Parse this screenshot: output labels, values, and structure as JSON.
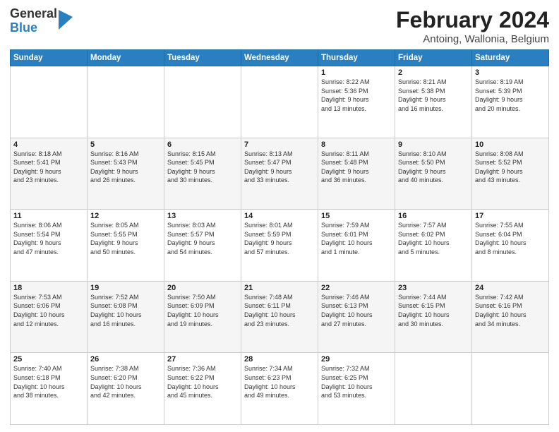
{
  "header": {
    "logo": {
      "general": "General",
      "blue": "Blue"
    },
    "title": "February 2024",
    "subtitle": "Antoing, Wallonia, Belgium"
  },
  "weekdays": [
    "Sunday",
    "Monday",
    "Tuesday",
    "Wednesday",
    "Thursday",
    "Friday",
    "Saturday"
  ],
  "weeks": [
    [
      {
        "day": "",
        "info": ""
      },
      {
        "day": "",
        "info": ""
      },
      {
        "day": "",
        "info": ""
      },
      {
        "day": "",
        "info": ""
      },
      {
        "day": "1",
        "info": "Sunrise: 8:22 AM\nSunset: 5:36 PM\nDaylight: 9 hours\nand 13 minutes."
      },
      {
        "day": "2",
        "info": "Sunrise: 8:21 AM\nSunset: 5:38 PM\nDaylight: 9 hours\nand 16 minutes."
      },
      {
        "day": "3",
        "info": "Sunrise: 8:19 AM\nSunset: 5:39 PM\nDaylight: 9 hours\nand 20 minutes."
      }
    ],
    [
      {
        "day": "4",
        "info": "Sunrise: 8:18 AM\nSunset: 5:41 PM\nDaylight: 9 hours\nand 23 minutes."
      },
      {
        "day": "5",
        "info": "Sunrise: 8:16 AM\nSunset: 5:43 PM\nDaylight: 9 hours\nand 26 minutes."
      },
      {
        "day": "6",
        "info": "Sunrise: 8:15 AM\nSunset: 5:45 PM\nDaylight: 9 hours\nand 30 minutes."
      },
      {
        "day": "7",
        "info": "Sunrise: 8:13 AM\nSunset: 5:47 PM\nDaylight: 9 hours\nand 33 minutes."
      },
      {
        "day": "8",
        "info": "Sunrise: 8:11 AM\nSunset: 5:48 PM\nDaylight: 9 hours\nand 36 minutes."
      },
      {
        "day": "9",
        "info": "Sunrise: 8:10 AM\nSunset: 5:50 PM\nDaylight: 9 hours\nand 40 minutes."
      },
      {
        "day": "10",
        "info": "Sunrise: 8:08 AM\nSunset: 5:52 PM\nDaylight: 9 hours\nand 43 minutes."
      }
    ],
    [
      {
        "day": "11",
        "info": "Sunrise: 8:06 AM\nSunset: 5:54 PM\nDaylight: 9 hours\nand 47 minutes."
      },
      {
        "day": "12",
        "info": "Sunrise: 8:05 AM\nSunset: 5:55 PM\nDaylight: 9 hours\nand 50 minutes."
      },
      {
        "day": "13",
        "info": "Sunrise: 8:03 AM\nSunset: 5:57 PM\nDaylight: 9 hours\nand 54 minutes."
      },
      {
        "day": "14",
        "info": "Sunrise: 8:01 AM\nSunset: 5:59 PM\nDaylight: 9 hours\nand 57 minutes."
      },
      {
        "day": "15",
        "info": "Sunrise: 7:59 AM\nSunset: 6:01 PM\nDaylight: 10 hours\nand 1 minute."
      },
      {
        "day": "16",
        "info": "Sunrise: 7:57 AM\nSunset: 6:02 PM\nDaylight: 10 hours\nand 5 minutes."
      },
      {
        "day": "17",
        "info": "Sunrise: 7:55 AM\nSunset: 6:04 PM\nDaylight: 10 hours\nand 8 minutes."
      }
    ],
    [
      {
        "day": "18",
        "info": "Sunrise: 7:53 AM\nSunset: 6:06 PM\nDaylight: 10 hours\nand 12 minutes."
      },
      {
        "day": "19",
        "info": "Sunrise: 7:52 AM\nSunset: 6:08 PM\nDaylight: 10 hours\nand 16 minutes."
      },
      {
        "day": "20",
        "info": "Sunrise: 7:50 AM\nSunset: 6:09 PM\nDaylight: 10 hours\nand 19 minutes."
      },
      {
        "day": "21",
        "info": "Sunrise: 7:48 AM\nSunset: 6:11 PM\nDaylight: 10 hours\nand 23 minutes."
      },
      {
        "day": "22",
        "info": "Sunrise: 7:46 AM\nSunset: 6:13 PM\nDaylight: 10 hours\nand 27 minutes."
      },
      {
        "day": "23",
        "info": "Sunrise: 7:44 AM\nSunset: 6:15 PM\nDaylight: 10 hours\nand 30 minutes."
      },
      {
        "day": "24",
        "info": "Sunrise: 7:42 AM\nSunset: 6:16 PM\nDaylight: 10 hours\nand 34 minutes."
      }
    ],
    [
      {
        "day": "25",
        "info": "Sunrise: 7:40 AM\nSunset: 6:18 PM\nDaylight: 10 hours\nand 38 minutes."
      },
      {
        "day": "26",
        "info": "Sunrise: 7:38 AM\nSunset: 6:20 PM\nDaylight: 10 hours\nand 42 minutes."
      },
      {
        "day": "27",
        "info": "Sunrise: 7:36 AM\nSunset: 6:22 PM\nDaylight: 10 hours\nand 45 minutes."
      },
      {
        "day": "28",
        "info": "Sunrise: 7:34 AM\nSunset: 6:23 PM\nDaylight: 10 hours\nand 49 minutes."
      },
      {
        "day": "29",
        "info": "Sunrise: 7:32 AM\nSunset: 6:25 PM\nDaylight: 10 hours\nand 53 minutes."
      },
      {
        "day": "",
        "info": ""
      },
      {
        "day": "",
        "info": ""
      }
    ]
  ]
}
